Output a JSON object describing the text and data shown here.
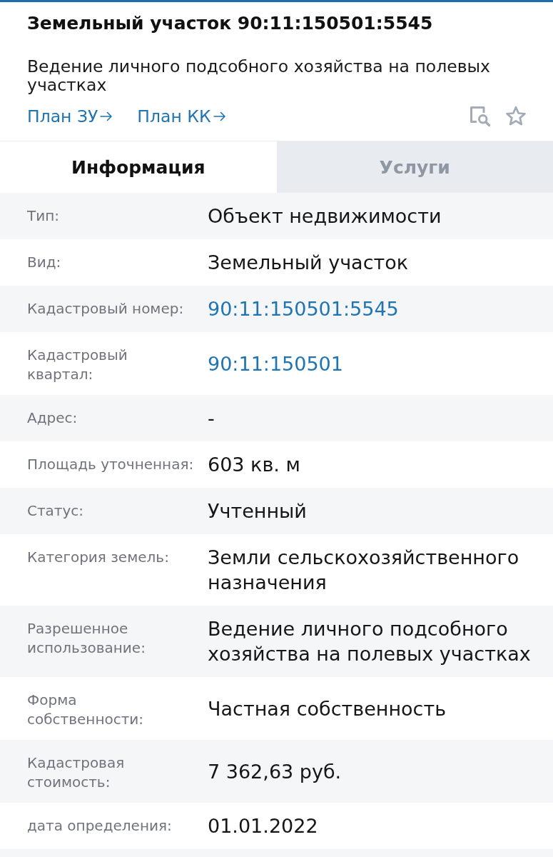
{
  "header": {
    "title": "Земельный участок 90:11:150501:5545",
    "subtitle": "Ведение личного подсобного хозяйства на полевых участках",
    "links": [
      "План ЗУ",
      "План КК"
    ]
  },
  "tabs": [
    {
      "label": "Информация",
      "selected": true
    },
    {
      "label": "Услуги",
      "selected": false
    }
  ],
  "rows": [
    {
      "label": "Тип:",
      "value": "Объект недвижимости",
      "kind": "text"
    },
    {
      "label": "Вид:",
      "value": "Земельный участок",
      "kind": "text"
    },
    {
      "label": "Кадастровый номер:",
      "value": "90:11:150501:5545",
      "kind": "link"
    },
    {
      "label": "Кадастровый квартал:",
      "value": "90:11:150501",
      "kind": "link"
    },
    {
      "label": "Адрес:",
      "value": "-",
      "kind": "text"
    },
    {
      "label": "Площадь уточненная:",
      "value": "603 кв. м",
      "kind": "text"
    },
    {
      "label": "Статус:",
      "value": "Учтенный",
      "kind": "text"
    },
    {
      "label": "Категория земель:",
      "value": "Земли сельскохозяйственного назначения",
      "kind": "text"
    },
    {
      "label": "Разрешенное использование:",
      "value": "Ведение личного подсобного хозяйства на полевых участках",
      "kind": "text"
    },
    {
      "label": "Форма собственности:",
      "value": "Частная собственность",
      "kind": "text"
    },
    {
      "label": "Кадастровая стоимость:",
      "value": "7 362,63 руб.",
      "kind": "text"
    },
    {
      "label": "дата определения:",
      "value": "01.01.2022",
      "kind": "text"
    }
  ]
}
